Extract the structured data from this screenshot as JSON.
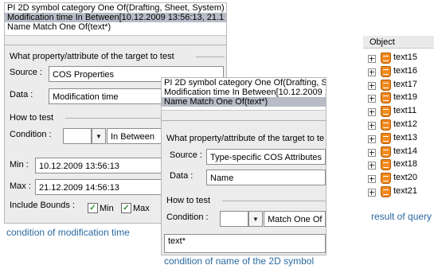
{
  "panel1": {
    "rules": [
      "PI 2D symbol category One Of(Drafting, Sheet, System)",
      "Modification time In Between[10.12.2009 13:56:13, 21.1",
      "Name Match One Of(text*)"
    ],
    "group_title": "What property/attribute of the target to test",
    "source_label": "Source :",
    "source_value": "COS Properties",
    "data_label": "Data :",
    "data_value": "Modification time",
    "how_title": "How to test",
    "condition_label": "Condition :",
    "condition_value": "In Between",
    "min_label": "Min :",
    "min_value": "10.12.2009 13:56:13",
    "max_label": "Max :",
    "max_value": "21.12.2009 14:56:13",
    "include_label": "Include Bounds :",
    "min_check_label": "Min",
    "max_check_label": "Max"
  },
  "panel2": {
    "rules": [
      "PI 2D symbol category One Of(Drafting, Sh",
      "Modification time In Between[10.12.2009 1",
      "Name Match One Of(text*)"
    ],
    "group_title": "What property/attribute of the target to te",
    "source_label": "Source :",
    "source_value": "Type-specific COS Attributes",
    "data_label": "Data :",
    "data_value": "Name",
    "how_title": "How to test",
    "condition_label": "Condition :",
    "condition_value": "Match One Of",
    "text_value": "text*"
  },
  "tree": {
    "header": "Object",
    "items": [
      "text15",
      "text16",
      "text17",
      "text19",
      "text11",
      "text12",
      "text13",
      "text14",
      "text18",
      "text20",
      "text21"
    ]
  },
  "captions": {
    "modification": "condition of modification time",
    "name": "condition of name of the 2D symbol",
    "result": "result of query"
  }
}
